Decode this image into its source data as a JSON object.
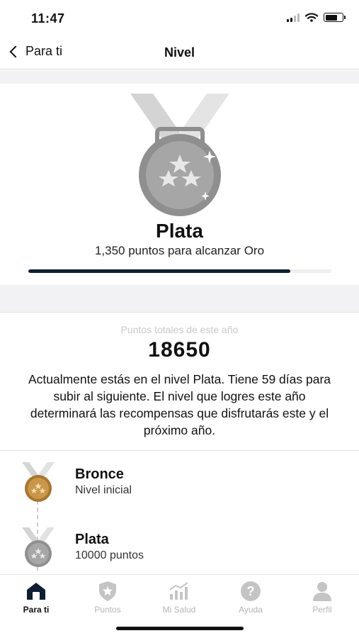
{
  "status_bar": {
    "time": "11:47"
  },
  "nav": {
    "back_label": "Para ti",
    "title": "Nivel"
  },
  "current_level": {
    "name": "Plata",
    "subtitle": "1,350 puntos para alcanzar Oro",
    "progress_fraction": 0.865
  },
  "points": {
    "caption": "Puntos totales de este año",
    "value": "18650",
    "description": "Actualmente estás en el nivel Plata. Tiene 59 días para subir al siguiente. El nivel que logres este año determinará las recompensas que disfrutarás este y el próximo año."
  },
  "levels": [
    {
      "name": "Bronce",
      "detail": "Nivel inicial",
      "medal": "bronze-medal-icon"
    },
    {
      "name": "Plata",
      "detail": "10000 puntos",
      "medal": "silver-medal-icon"
    }
  ],
  "tabs": [
    {
      "label": "Para ti",
      "icon": "home-icon",
      "active": true
    },
    {
      "label": "Puntos",
      "icon": "shield-star-icon",
      "active": false
    },
    {
      "label": "Mi Salud",
      "icon": "bar-chart-icon",
      "active": false
    },
    {
      "label": "Ayuda",
      "icon": "help-icon",
      "active": false
    },
    {
      "label": "Perfil",
      "icon": "person-icon",
      "active": false
    }
  ],
  "colors": {
    "progress": "#0f1f33",
    "silver": "#9a9a9a",
    "bronze": "#b98a3e",
    "inactive_tab": "#b5b5b5"
  }
}
